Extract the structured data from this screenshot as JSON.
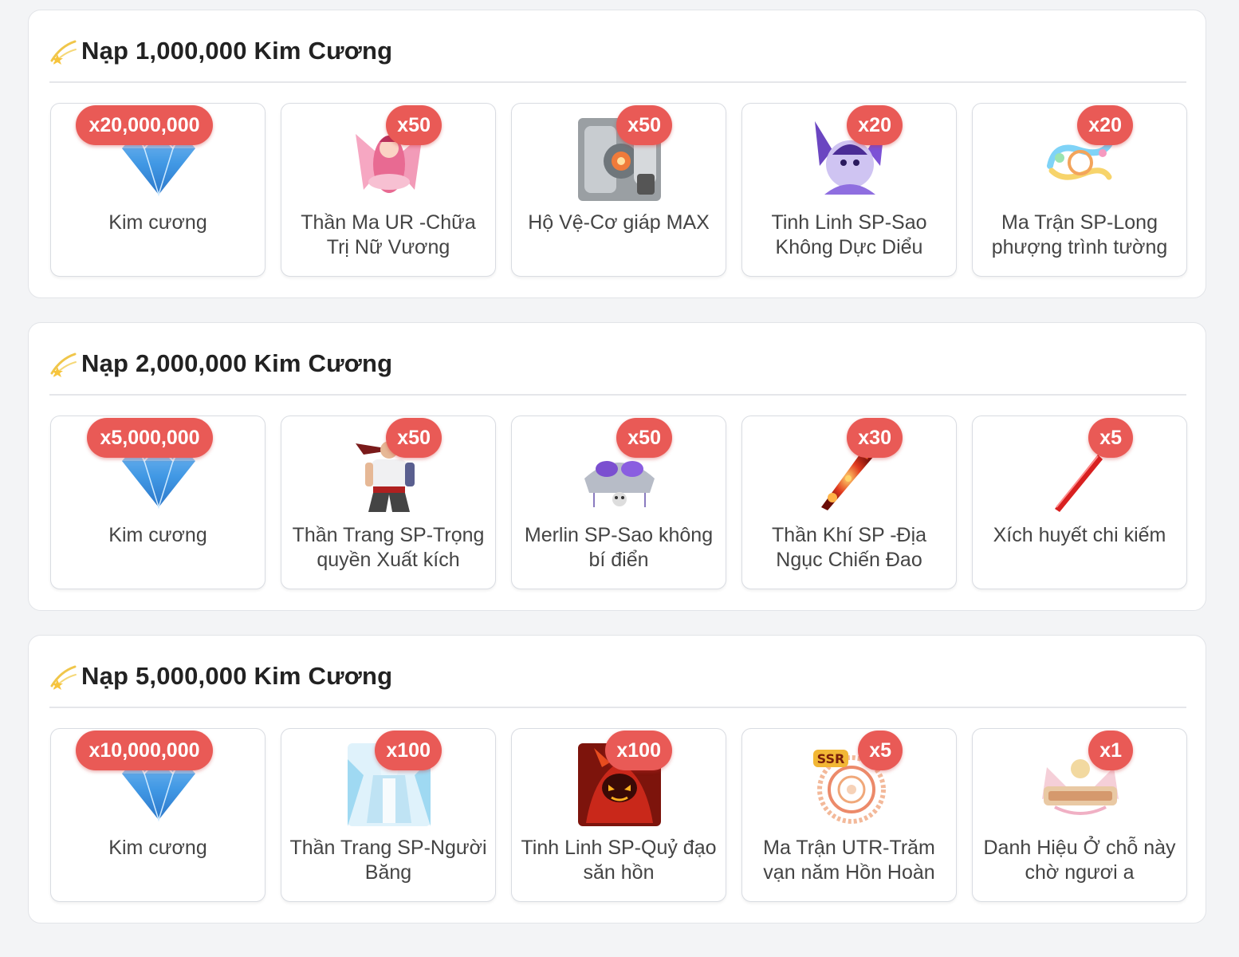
{
  "sections": [
    {
      "title": "Nạp 1,000,000 Kim Cương",
      "icon": "shooting-star-icon",
      "items": [
        {
          "badge": "x20,000,000",
          "name": "Kim cương",
          "icon": "diamond-icon"
        },
        {
          "badge": "x50",
          "name": "Thần Ma UR -Chữa Trị Nữ Vương",
          "icon": "pink-goddess-icon"
        },
        {
          "badge": "x50",
          "name": "Hộ Vệ-Cơ giáp MAX",
          "icon": "mech-armor-icon"
        },
        {
          "badge": "x20",
          "name": "Tinh Linh SP-Sao Không Dực Diểu",
          "icon": "purple-beast-icon"
        },
        {
          "badge": "x20",
          "name": "Ma Trận SP-Long phượng trình tường",
          "icon": "rainbow-dragon-icon"
        }
      ]
    },
    {
      "title": "Nạp 2,000,000 Kim Cương",
      "icon": "shooting-star-icon",
      "items": [
        {
          "badge": "x5,000,000",
          "name": "Kim cương",
          "icon": "diamond-icon"
        },
        {
          "badge": "x50",
          "name": "Thần Trang SP-Trọng quyền Xuất kích",
          "icon": "fighter-costume-icon"
        },
        {
          "badge": "x50",
          "name": "Merlin SP-Sao không bí điển",
          "icon": "jeweled-crown-icon"
        },
        {
          "badge": "x30",
          "name": "Thần Khí SP -Địa Ngục Chiến Đao",
          "icon": "flame-sword-icon"
        },
        {
          "badge": "x5",
          "name": "Xích huyết chi kiếm",
          "icon": "red-sword-icon"
        }
      ]
    },
    {
      "title": "Nạp 5,000,000 Kim Cương",
      "icon": "shooting-star-icon",
      "items": [
        {
          "badge": "x10,000,000",
          "name": "Kim cương",
          "icon": "diamond-icon"
        },
        {
          "badge": "x100",
          "name": "Thần Trang SP-Người Băng",
          "icon": "ice-costume-icon"
        },
        {
          "badge": "x100",
          "name": "Tinh Linh SP-Quỷ đạo săn hồn",
          "icon": "fire-demon-icon"
        },
        {
          "badge": "x5",
          "name": "Ma Trận UTR-Trăm vạn năm Hồn Hoàn",
          "icon": "ssr-ring-icon"
        },
        {
          "badge": "x1",
          "name": "Danh Hiệu Ở chỗ này chờ ngươi a",
          "icon": "title-banner-icon"
        }
      ]
    }
  ],
  "colors": {
    "badge": "#e95a56",
    "card_border": "#d9dce2",
    "page_bg": "#f3f4f6"
  }
}
